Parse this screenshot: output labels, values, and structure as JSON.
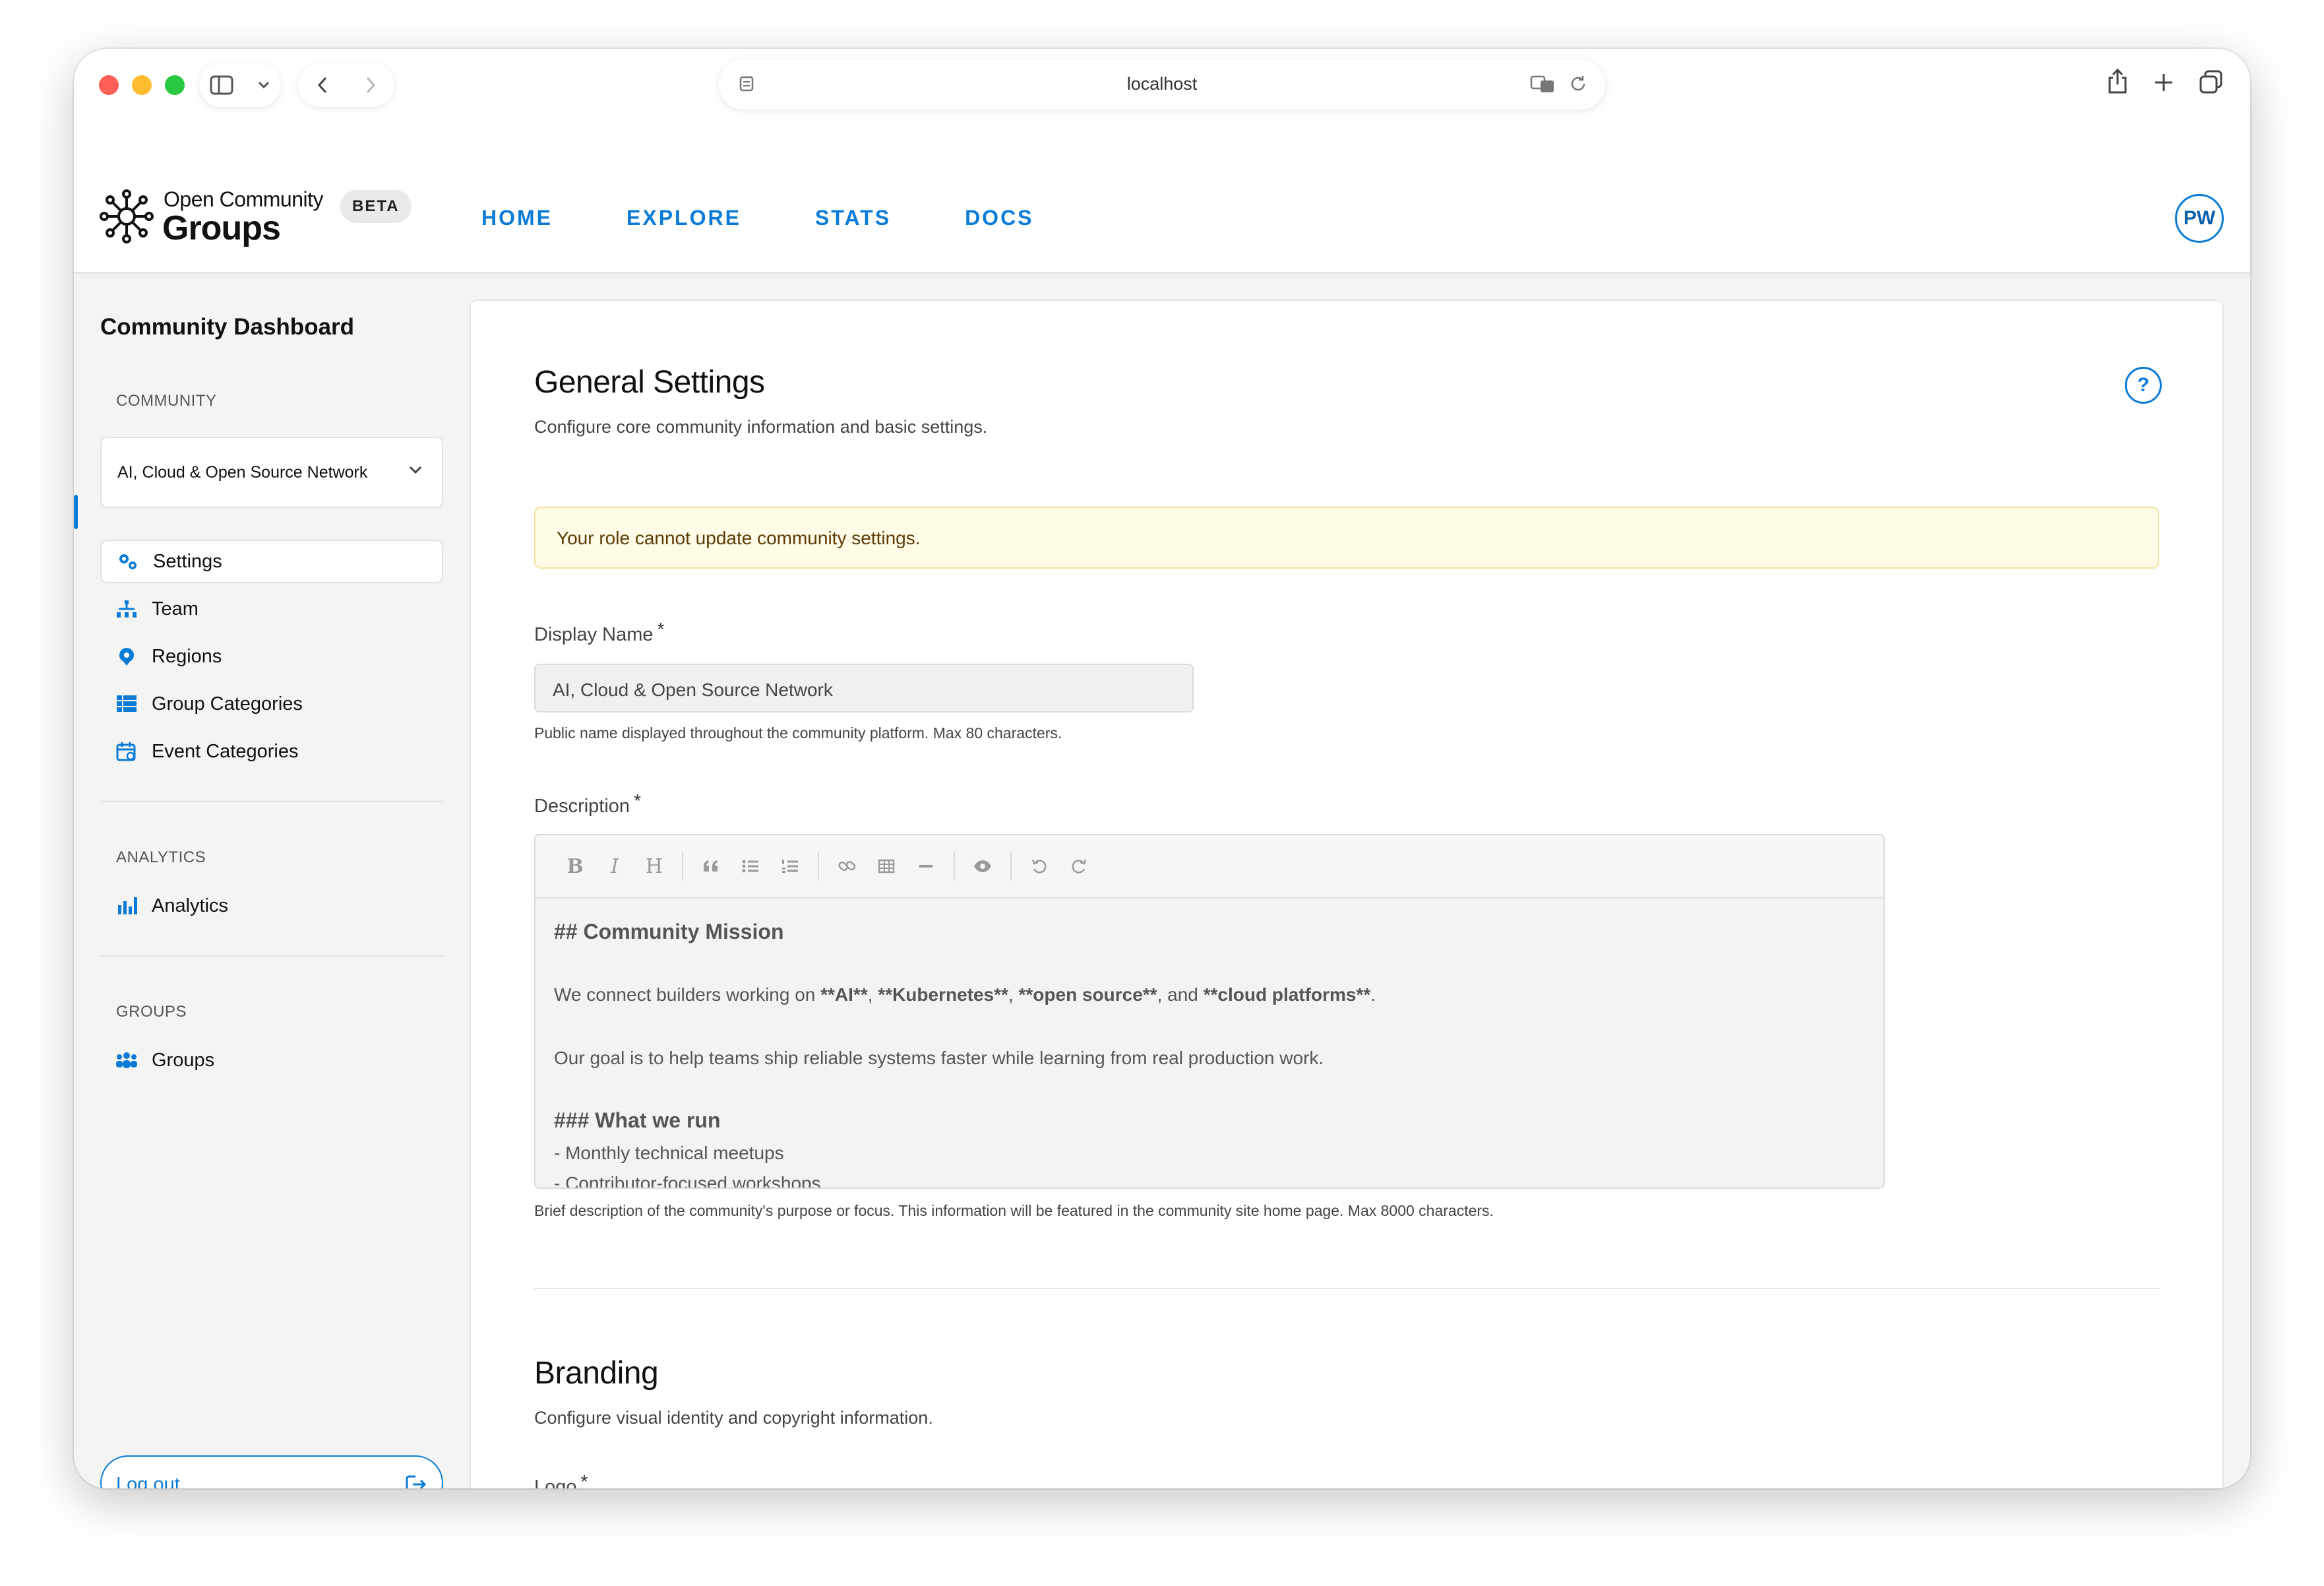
{
  "browser": {
    "url": "localhost"
  },
  "app": {
    "logo_line1": "Open Community",
    "logo_line2": "Groups",
    "beta": "BETA",
    "nav": [
      "HOME",
      "EXPLORE",
      "STATS",
      "DOCS"
    ],
    "avatar_initials": "PW",
    "accent_color": "#0a7bd6"
  },
  "sidebar": {
    "title": "Community Dashboard",
    "community_label": "COMMUNITY",
    "community_selected": "AI, Cloud & Open Source Network",
    "items": [
      {
        "label": "Settings",
        "icon": "gears-icon",
        "active": true
      },
      {
        "label": "Team",
        "icon": "org-chart-icon"
      },
      {
        "label": "Regions",
        "icon": "map-pin-icon"
      },
      {
        "label": "Group Categories",
        "icon": "list-icon"
      },
      {
        "label": "Event Categories",
        "icon": "calendar-icon"
      }
    ],
    "analytics_label": "ANALYTICS",
    "analytics_item": "Analytics",
    "groups_label": "GROUPS",
    "groups_item": "Groups",
    "logout": "Log out"
  },
  "main": {
    "title": "General Settings",
    "subtitle": "Configure core community information and basic settings.",
    "alert": "Your role cannot update community settings.",
    "display_name": {
      "label": "Display Name",
      "required": "*",
      "value": "AI, Cloud & Open Source Network",
      "help": "Public name displayed throughout the community platform. Max 80 characters."
    },
    "description": {
      "label": "Description",
      "required": "*",
      "help": "Brief description of the community's purpose or focus. This information will be featured in the community site home page. Max 8000 characters.",
      "toolbar": [
        "B",
        "I",
        "H",
        "quote",
        "bullet-list",
        "numbered-list",
        "link",
        "table",
        "horizontal-rule",
        "preview",
        "undo",
        "redo"
      ],
      "heading1": "## Community Mission",
      "para1_prefix": "We connect builders working on ",
      "para1_b1": "**AI**",
      "para1_c1": ", ",
      "para1_b2": "**Kubernetes**",
      "para1_c2": ", ",
      "para1_b3": "**open source**",
      "para1_c3": ", and ",
      "para1_b4": "**cloud platforms**",
      "para1_end": ".",
      "para2": "Our goal is to help teams ship reliable systems faster while learning from real production work.",
      "heading2": "### What we run",
      "list1": "- Monthly technical meetups",
      "list2": "- Contributor-focused workshops"
    },
    "branding_title": "Branding",
    "branding_subtitle": "Configure visual identity and copyright information.",
    "logo_label": "Logo",
    "logo_required": "*"
  }
}
